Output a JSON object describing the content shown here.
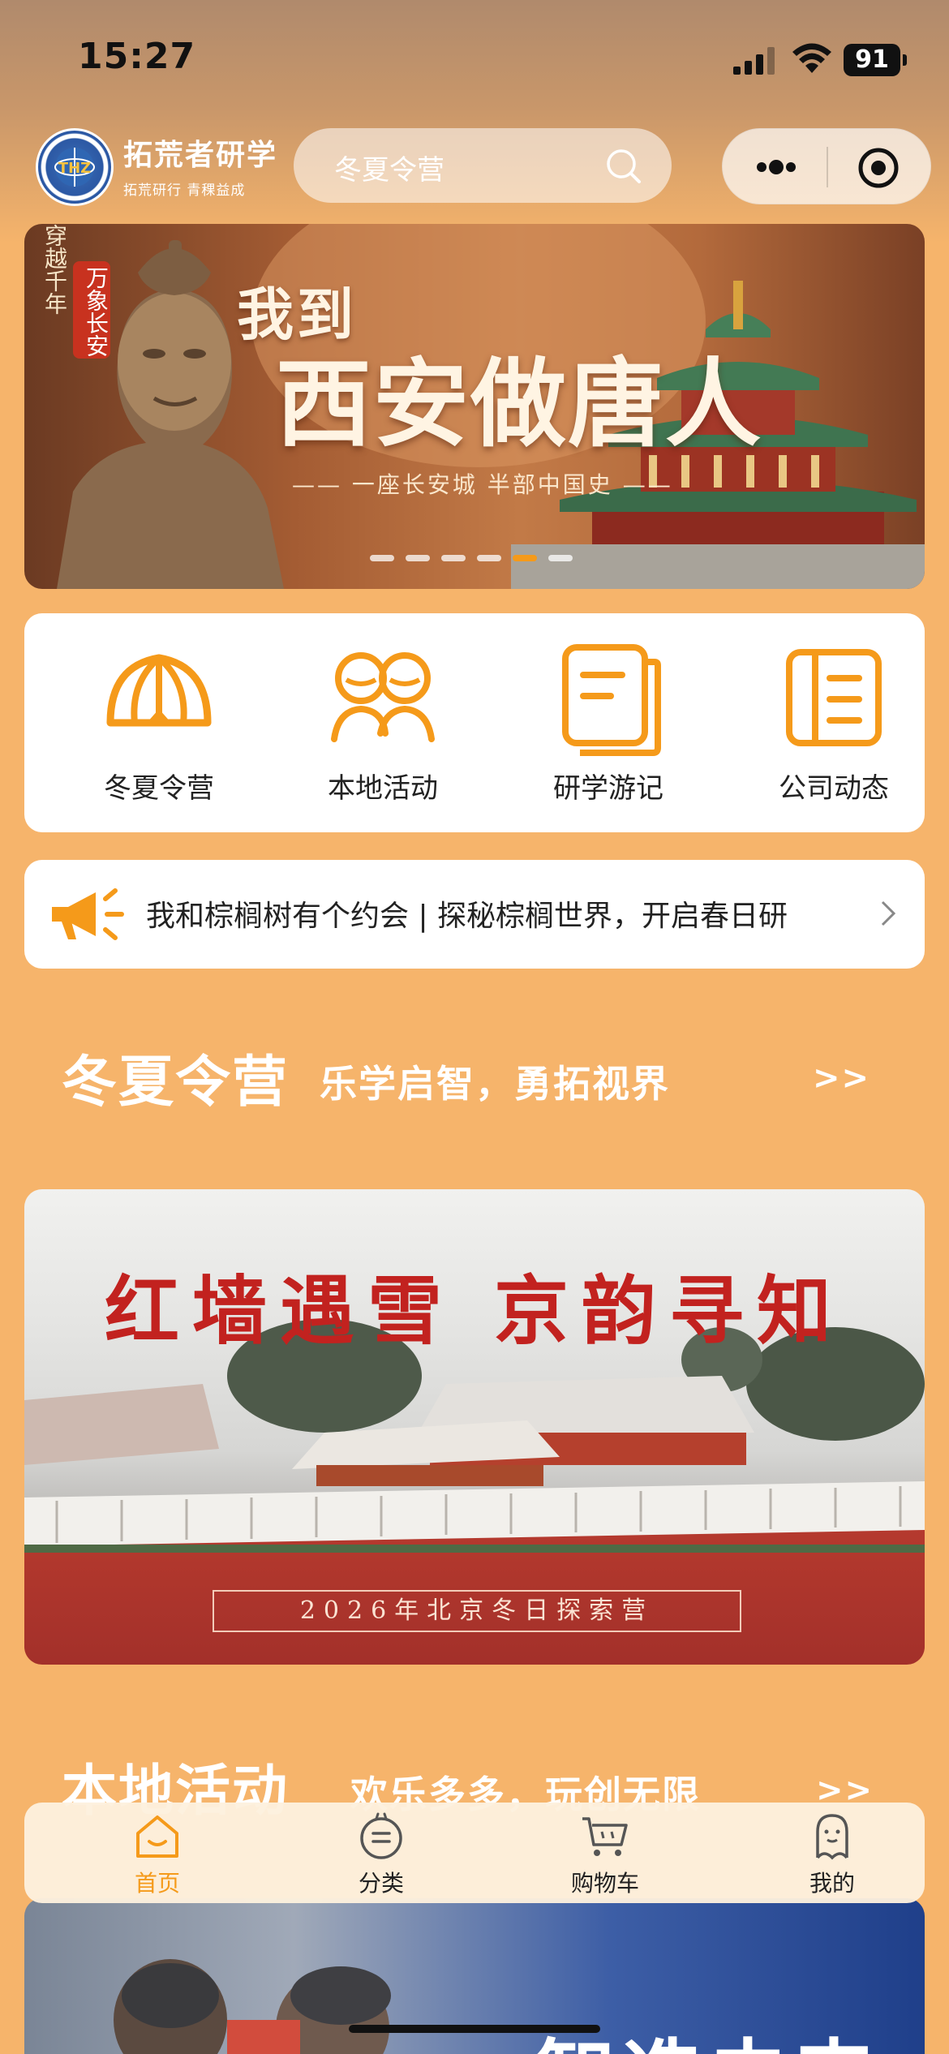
{
  "status_bar": {
    "time": "15:27",
    "battery": "91"
  },
  "header": {
    "logo_name": "拓荒者研学",
    "logo_slogan": "拓荒研行  青稞益成",
    "search_placeholder": "冬夏令营"
  },
  "hero": {
    "vertical_text": "穿越千年",
    "seal_text": "万象长安",
    "line1": "我到",
    "line2": "西安做唐人",
    "subtitle": "—— 一座长安城  半部中国史 ——",
    "slide_count": 6,
    "active_slide": 5
  },
  "quick_nav": [
    {
      "label": "冬夏令营",
      "icon": "tent-icon"
    },
    {
      "label": "本地活动",
      "icon": "people-icon"
    },
    {
      "label": "研学游记",
      "icon": "notes-icon"
    },
    {
      "label": "公司动态",
      "icon": "document-icon"
    }
  ],
  "notice": {
    "text": "我和棕榈树有个约会 | 探秘棕榈世界，开启春日研"
  },
  "section_camp": {
    "title": "冬夏令营",
    "subtitle": "乐学启智，勇拓视界",
    "more": ">>",
    "banner_title": "红墙遇雪  京韵寻知",
    "banner_caption": "2026年北京冬日探索营"
  },
  "section_local": {
    "title": "本地活动",
    "subtitle": "欢乐多多，玩创无限",
    "more": ">>",
    "banner_text": "智造未来"
  },
  "tabbar": {
    "items": [
      {
        "label": "首页",
        "icon": "home-icon",
        "active": true
      },
      {
        "label": "分类",
        "icon": "category-icon",
        "active": false
      },
      {
        "label": "购物车",
        "icon": "cart-icon",
        "active": false
      },
      {
        "label": "我的",
        "icon": "profile-icon",
        "active": false
      }
    ]
  },
  "colors": {
    "accent": "#F59A1A",
    "page_bg": "#F6B46B",
    "brand_red": "#C2221F"
  }
}
